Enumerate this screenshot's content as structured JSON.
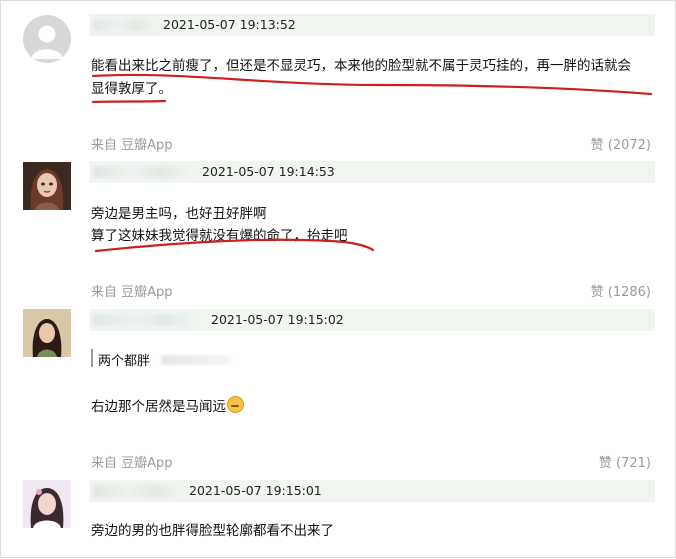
{
  "comments": [
    {
      "time": "2021-05-07 19:13:52",
      "lines": [
        "能看出来比之前瘦了，但还是不显灵巧，本来他的脸型就不属于灵巧挂的，再一胖的话就会",
        "显得敦厚了。"
      ],
      "source": "来自 豆瓣App",
      "likes": "赞 (2072)"
    },
    {
      "time": "2021-05-07 19:14:53",
      "lines": [
        "旁边是男主吗，也好丑好胖啊",
        "算了这妹妹我觉得就没有爆的命了，抬走吧"
      ],
      "source": "来自 豆瓣App",
      "likes": "赞 (1286)"
    },
    {
      "time": "2021-05-07 19:15:02",
      "quote": "两个都胖",
      "lines": [
        "右边那个居然是马闻远"
      ],
      "source": "来自 豆瓣App",
      "likes": "赞 (721)"
    },
    {
      "time": "2021-05-07 19:15:01",
      "lines": [
        "旁边的男的也胖得脸型轮廓都看不出来了"
      ]
    }
  ],
  "colors": {
    "underline": "#cc1f1f",
    "meta_bg": "#f0f5f0"
  }
}
